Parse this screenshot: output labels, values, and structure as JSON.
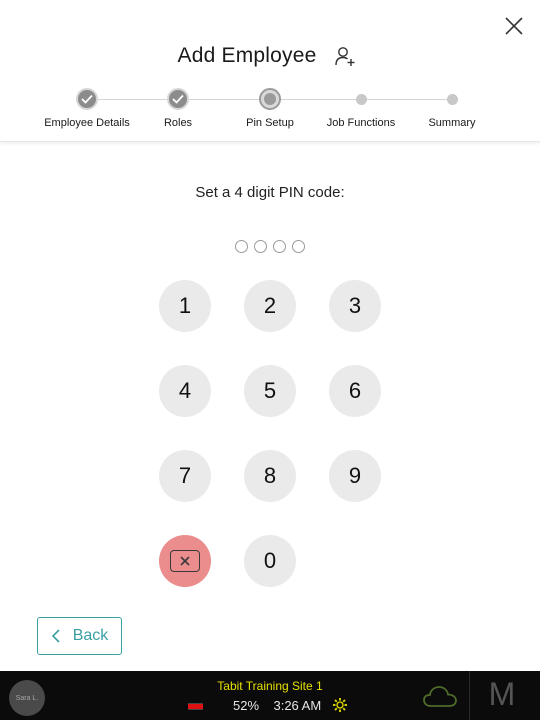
{
  "header": {
    "title": "Add Employee",
    "close_icon": "close-icon",
    "title_icon": "add-user-icon"
  },
  "stepper": {
    "steps": [
      {
        "label": "Employee Details",
        "state": "completed"
      },
      {
        "label": "Roles",
        "state": "completed"
      },
      {
        "label": "Pin Setup",
        "state": "active"
      },
      {
        "label": "Job Functions",
        "state": "pending"
      },
      {
        "label": "Summary",
        "state": "pending"
      }
    ]
  },
  "pin": {
    "prompt": "Set a 4 digit PIN code:",
    "length": 4,
    "entered": 0
  },
  "keypad": {
    "keys": [
      "1",
      "2",
      "3",
      "4",
      "5",
      "6",
      "7",
      "8",
      "9",
      "0"
    ],
    "delete_icon": "backspace-icon",
    "delete_color": "#ec8d8d"
  },
  "footer": {
    "back_label": "Back",
    "back_color": "#3a9fa2"
  },
  "statusbar": {
    "user": "Sara L.",
    "site": "Tabit Training Site 1",
    "battery": "52%",
    "time": "3:26 AM",
    "logo": "M",
    "site_color": "#e5e000"
  }
}
